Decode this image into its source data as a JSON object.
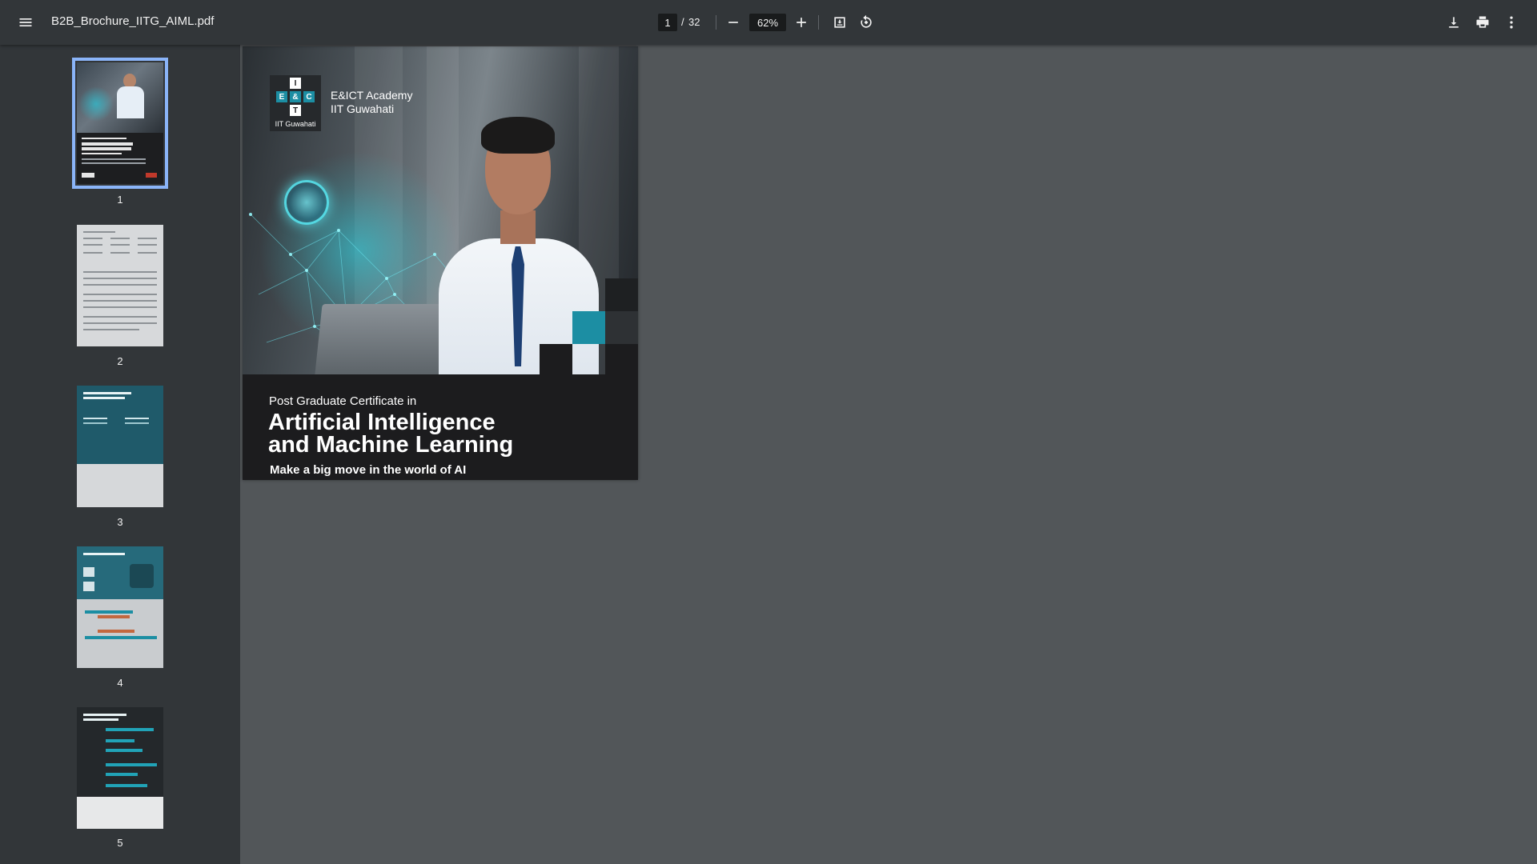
{
  "toolbar": {
    "file_name": "B2B_Brochure_IITG_AIML.pdf",
    "current_page": "1",
    "page_separator": "/",
    "total_pages": "32",
    "zoom": "62%",
    "icons": [
      "menu-icon",
      "minus-icon",
      "plus-icon",
      "fit-page-icon",
      "rotate-icon",
      "download-icon",
      "print-icon",
      "more-vert-icon"
    ]
  },
  "sidebar": {
    "thumbnails": [
      {
        "label": "1",
        "selected": true
      },
      {
        "label": "2",
        "selected": false
      },
      {
        "label": "3",
        "selected": false
      },
      {
        "label": "4",
        "selected": false
      },
      {
        "label": "5",
        "selected": false
      }
    ]
  },
  "document": {
    "logo": {
      "letters": [
        "I",
        "E",
        "&",
        "C",
        "T"
      ],
      "caption": "IIT Guwahati"
    },
    "academy_line1": "E&ICT Academy",
    "academy_line2": "IIT Guwahati",
    "subtitle": "Post Graduate Certificate in",
    "title_line1": "Artificial Intelligence",
    "title_line2": "and Machine Learning",
    "tagline": "Make a big move in the world of AI"
  },
  "colors": {
    "toolbar_bg": "#323639",
    "viewer_bg": "#525659",
    "selection": "#8ab4f8",
    "brand_teal": "#1c8ea3"
  }
}
